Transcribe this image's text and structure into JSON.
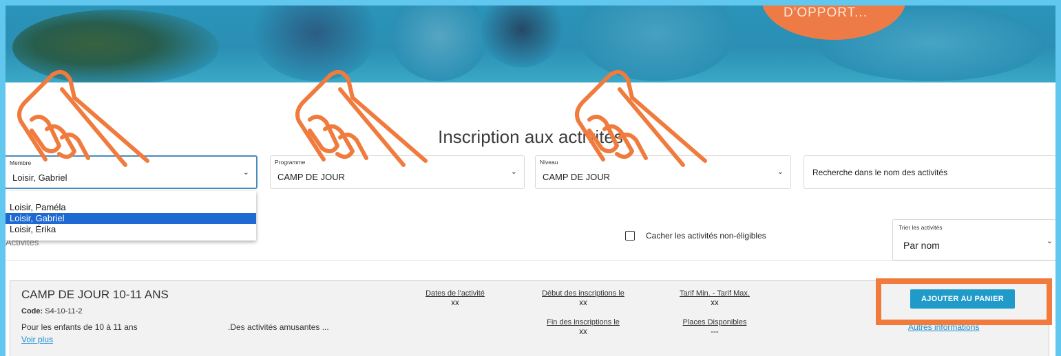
{
  "hero": {
    "badge_text": "D'OPPORT..."
  },
  "page_title": "Inscription aux activités",
  "filters": {
    "membre": {
      "label": "Membre",
      "value": "Loisir, Gabriel"
    },
    "programme": {
      "label": "Programme",
      "value": "CAMP DE JOUR"
    },
    "niveau": {
      "label": "Niveau",
      "value": "CAMP DE JOUR"
    },
    "search": {
      "placeholder": "Recherche dans le nom des activités"
    }
  },
  "membre_dropdown": {
    "options": [
      "Loisir, Paméla",
      "Loisir, Gabriel",
      "Loisir, Érika"
    ],
    "selected_index": 1
  },
  "activities_label": "Activités",
  "hide_ineligible": {
    "label": "Cacher les activités non-éligibles",
    "checked": false
  },
  "sort": {
    "label": "Trier les activités",
    "value": "Par nom"
  },
  "activity": {
    "title": "CAMP DE JOUR 10-11 ANS",
    "code_label": "Code:",
    "code_value": "S4-10-11-2",
    "description": "Pour les enfants de 10 à 11 ans",
    "see_more": "Voir plus",
    "excerpt": ".Des activités amusantes ...",
    "dates_label": "Dates de l'activité",
    "dates_value": "xx",
    "start_label": "Début des inscriptions le",
    "start_value": "xx",
    "end_label": "Fin des inscriptions le",
    "end_value": "xx",
    "tarif_label": "Tarif Min. - Tarif Max.",
    "tarif_value": "xx",
    "places_label": "Places Disponibles",
    "places_value": "---",
    "add_button": "AJOUTER AU PANIER",
    "other_info": "Autres informations"
  },
  "colors": {
    "annotation_orange": "#f07b3d",
    "primary_button": "#1f9ac9",
    "link": "#1a8fd1",
    "selected_option": "#1e6ad2",
    "page_background": "#62c7ee"
  },
  "icons": [
    "chevron-down-icon",
    "checkbox-icon",
    "pointing-hand-icon"
  ]
}
